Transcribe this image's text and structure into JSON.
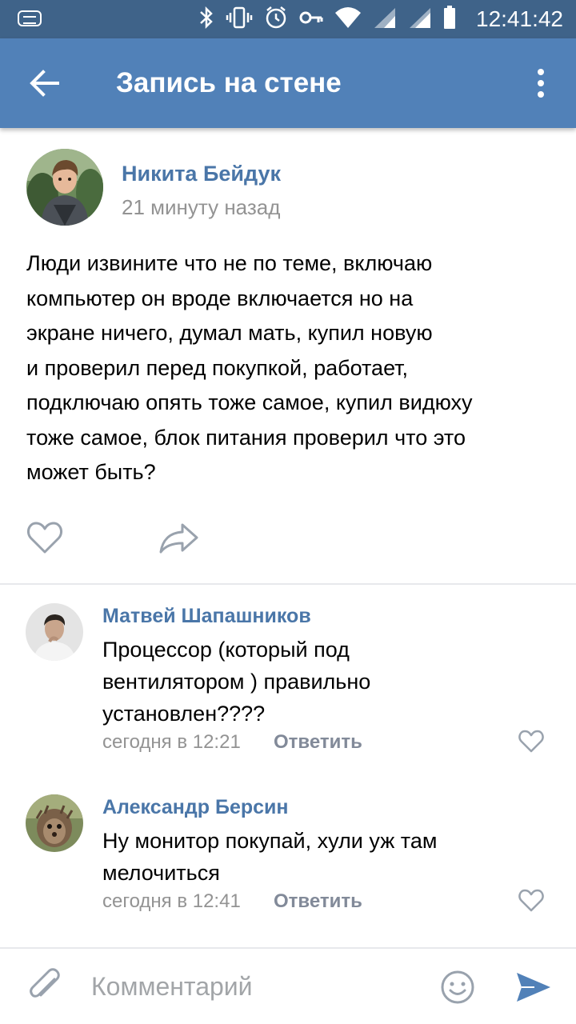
{
  "status_bar": {
    "time": "12:41:42",
    "icons": [
      "keyboard-icon",
      "bluetooth-icon",
      "vibrate-icon",
      "alarm-icon",
      "key-icon",
      "wifi-icon",
      "signal-icon",
      "signal-icon",
      "battery-icon"
    ]
  },
  "app_bar": {
    "title": "Запись на стене",
    "back_icon": "arrow-back-icon",
    "more_icon": "more-vertical-icon"
  },
  "post": {
    "author": "Никита Бейдук",
    "time": "21 минуту назад",
    "text_lines": [
      "Люди извините что не по теме, включаю",
      "компьютер он вроде включается но на",
      "экране ничего, думал мать, купил новую",
      "и проверил перед покупкой, работает,",
      "подключаю опять тоже самое, купил видюху",
      "тоже самое, блок питания проверил что это",
      "может быть?"
    ]
  },
  "comments": [
    {
      "author": "Матвей Шапашников",
      "text_lines": [
        "Процессор (который под",
        "вентилятором ) правильно",
        "установлен????"
      ],
      "time": "сегодня в 12:21",
      "reply": "Ответить"
    },
    {
      "author": "Александр Берсин",
      "text_lines": [
        "Ну монитор покупай, хули уж там",
        "мелочиться"
      ],
      "time": "сегодня в 12:41",
      "reply": "Ответить"
    }
  ],
  "composer": {
    "placeholder": "Комментарий"
  },
  "colors": {
    "status_bar": "#3f6389",
    "app_bar": "#5181b8",
    "link": "#4a76a8",
    "secondary_text": "#939393",
    "icon": "#99a2ad",
    "send": "#5181b8"
  }
}
